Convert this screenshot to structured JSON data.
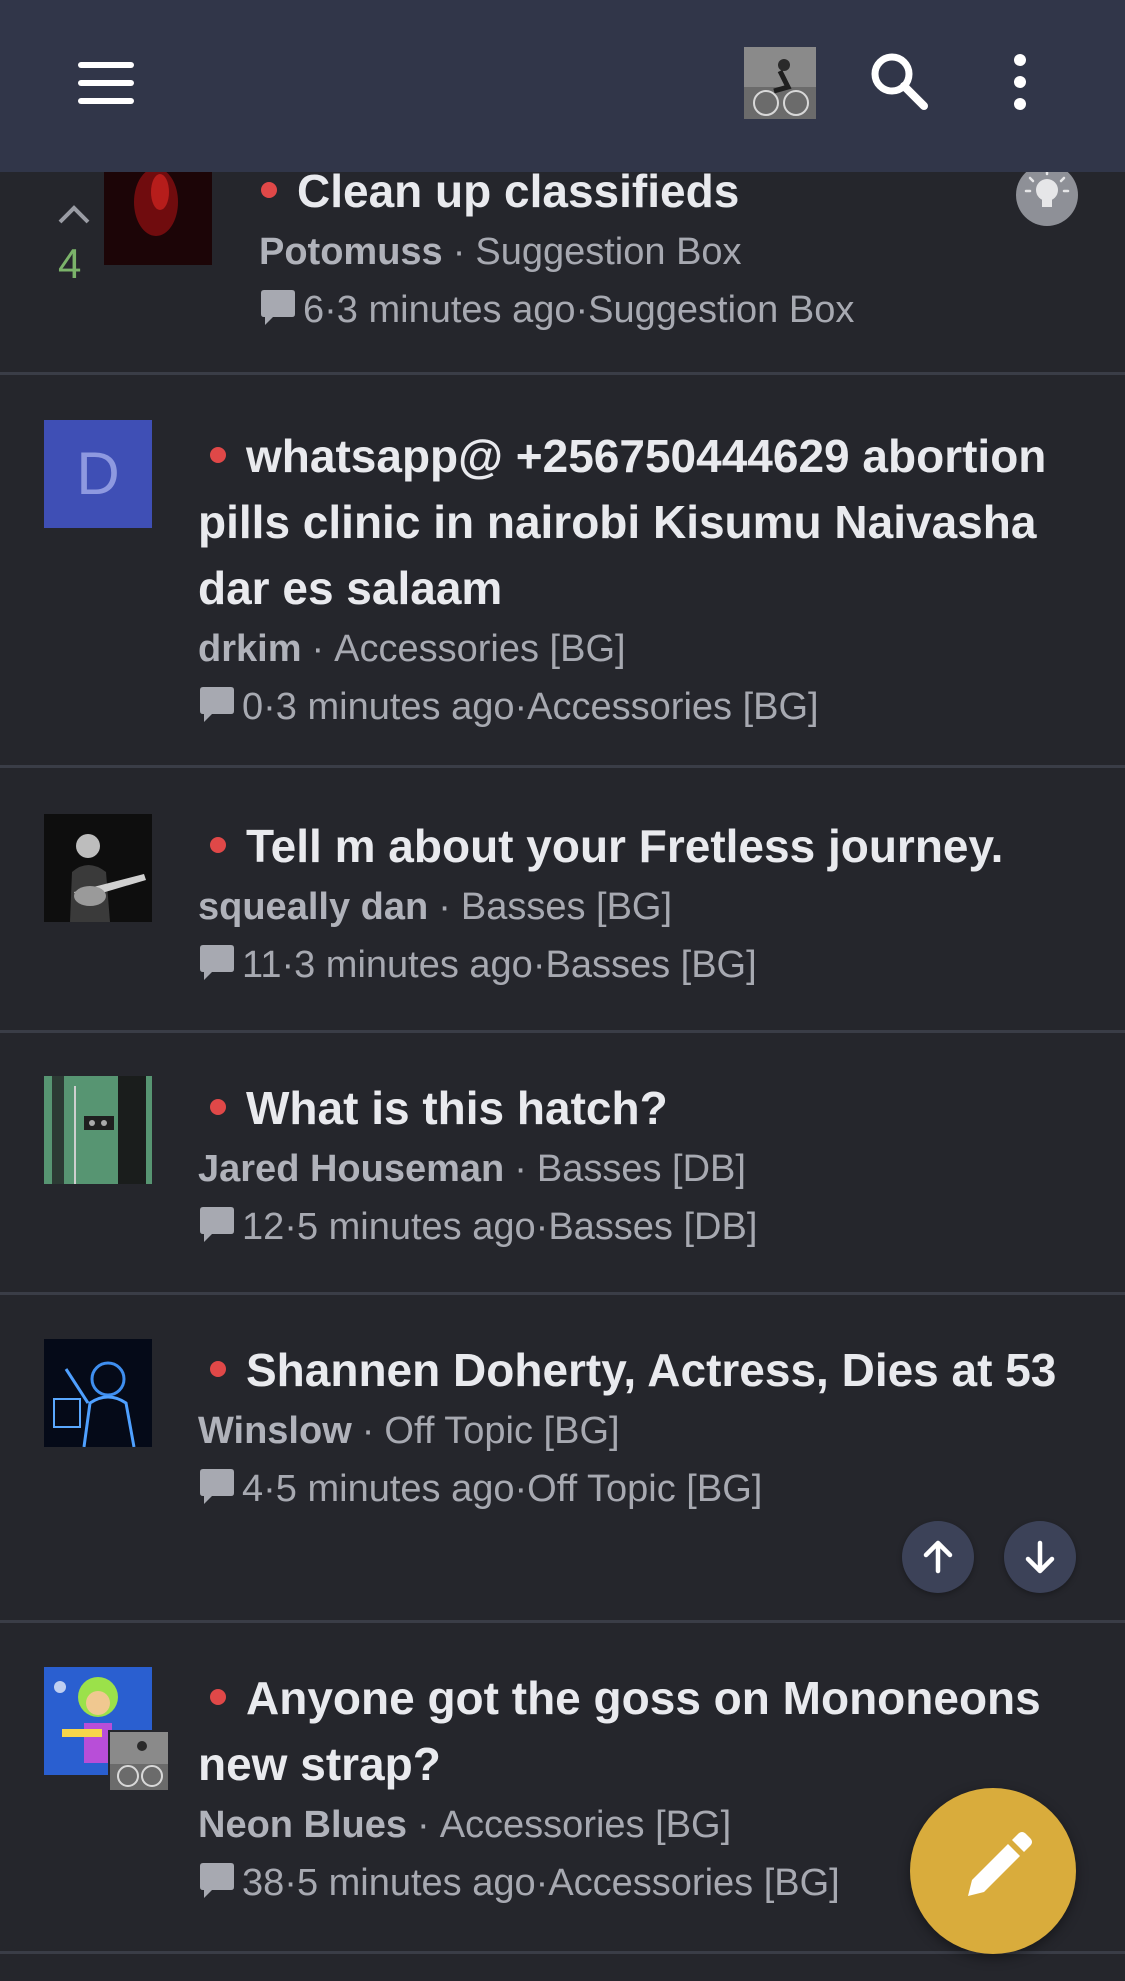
{
  "topbar": {
    "menu_icon": "hamburger-menu-icon",
    "avatar_icon": "user-avatar",
    "search_icon": "search-icon",
    "more_icon": "more-vertical-icon"
  },
  "topics": [
    {
      "title": "Clean up classifieds",
      "author": "Potomuss",
      "category": "Suggestion Box",
      "replies": "6",
      "time": "3 minutes ago",
      "category2": "Suggestion Box",
      "votes": "4"
    },
    {
      "title": "whatsapp@ +256750444629 abortion pills clinic in nairobi Kisumu Naivasha dar es salaam",
      "author": "drkim",
      "category": "Accessories [BG]",
      "replies": "0",
      "time": "3 minutes ago",
      "category2": "Accessories [BG]",
      "avatar_letter": "D"
    },
    {
      "title": "Tell m about your Fretless journey.",
      "author": "squeally dan",
      "category": "Basses [BG]",
      "replies": "11",
      "time": "3 minutes ago",
      "category2": "Basses [BG]"
    },
    {
      "title": "What is this hatch?",
      "author": "Jared Houseman",
      "category": "Basses [DB]",
      "replies": "12",
      "time": "5 minutes ago",
      "category2": "Basses [DB]"
    },
    {
      "title": "Shannen Doherty, Actress, Dies at 53",
      "author": "Winslow",
      "category": "Off Topic [BG]",
      "replies": "4",
      "time": "5 minutes ago",
      "category2": "Off Topic [BG]"
    },
    {
      "title": "Anyone got the goss on Mononeons new strap?",
      "author": "Neon Blues",
      "category": "Accessories [BG]",
      "replies": "38",
      "time": "5 minutes ago",
      "category2": "Accessories [BG]"
    }
  ],
  "controls": {
    "scroll_up_icon": "arrow-up-icon",
    "scroll_down_icon": "arrow-down-icon",
    "compose_icon": "pencil-icon",
    "solved_icon": "lightbulb-icon"
  },
  "colors": {
    "header_bg": "#313649",
    "page_bg": "#25262c",
    "unread_dot": "#e04848",
    "fab": "#d9ac3c",
    "vote_count": "#7bb36a",
    "letter_avatar": "#3f4fb5"
  }
}
